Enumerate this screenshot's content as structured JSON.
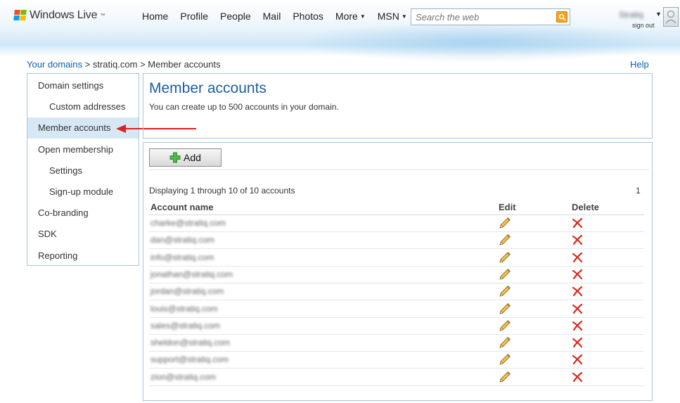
{
  "brand": {
    "name": "Windows Live",
    "tm": "™"
  },
  "nav": [
    {
      "label": "Home",
      "caret": false
    },
    {
      "label": "Profile",
      "caret": false
    },
    {
      "label": "People",
      "caret": false
    },
    {
      "label": "Mail",
      "caret": false
    },
    {
      "label": "Photos",
      "caret": false
    },
    {
      "label": "More",
      "caret": true
    },
    {
      "label": "MSN",
      "caret": true
    }
  ],
  "search": {
    "placeholder": "Search the web",
    "icon": "search-icon"
  },
  "user": {
    "name": "Stratiq",
    "signout": "sign out"
  },
  "breadcrumb": {
    "root": "Your domains",
    "sep1": ">",
    "domain": "stratiq.com",
    "sep2": ">",
    "current": "Member accounts"
  },
  "help": "Help",
  "sidebar": [
    {
      "label": "Domain settings",
      "indent": 0,
      "active": false
    },
    {
      "label": "Custom addresses",
      "indent": 1,
      "active": false
    },
    {
      "label": "Member accounts",
      "indent": 0,
      "active": true
    },
    {
      "label": "Open membership",
      "indent": 0,
      "active": false
    },
    {
      "label": "Settings",
      "indent": 1,
      "active": false
    },
    {
      "label": "Sign-up module",
      "indent": 1,
      "active": false
    },
    {
      "label": "Co-branding",
      "indent": 0,
      "active": false
    },
    {
      "label": "SDK",
      "indent": 0,
      "active": false
    },
    {
      "label": "Reporting",
      "indent": 0,
      "active": false
    }
  ],
  "title": {
    "heading": "Member accounts",
    "subtitle": "You can create up to 500 accounts in your domain."
  },
  "list": {
    "add_label": "Add",
    "summary": "Displaying 1 through 10 of 10 accounts",
    "page": "1",
    "columns": {
      "account": "Account name",
      "edit": "Edit",
      "delete": "Delete"
    },
    "accounts": [
      "charke@stratiq.com",
      "dan@stratiq.com",
      "info@stratiq.com",
      "jonathan@stratiq.com",
      "jordan@stratiq.com",
      "louis@stratiq.com",
      "sales@stratiq.com",
      "sheldon@stratiq.com",
      "support@stratiq.com",
      "zion@stratiq.com"
    ]
  },
  "colors": {
    "link": "#0b5fb4",
    "heading": "#1d5fa0",
    "border": "#a9c3da",
    "active_bg": "#d7e8f5",
    "arrow": "#e02020"
  }
}
